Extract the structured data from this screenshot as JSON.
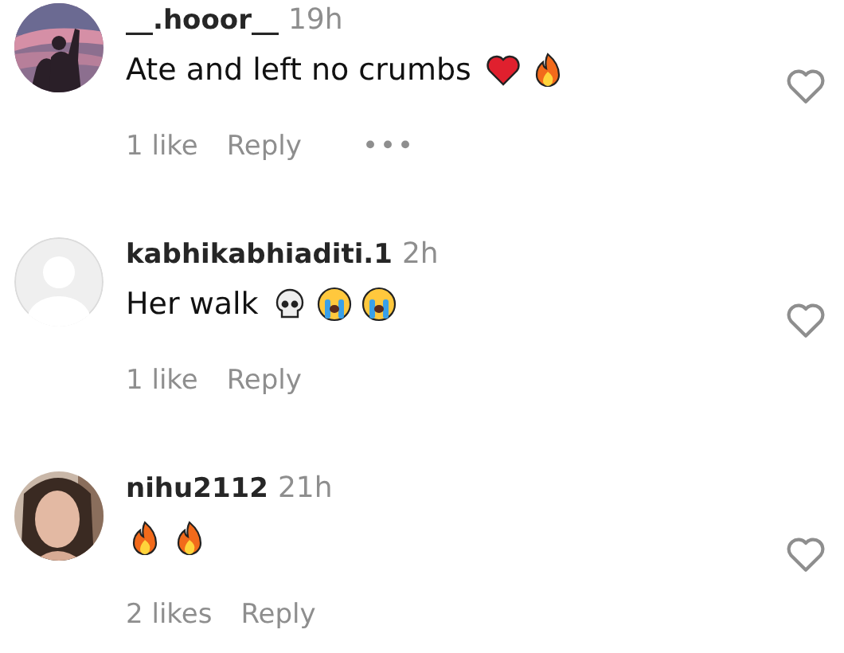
{
  "comments": [
    {
      "avatar": {
        "kind": "sunset"
      },
      "username": "__.hooor__",
      "time": "19h",
      "text": "Ate and left no crumbs",
      "emojis": [
        {
          "kind": "heart"
        },
        {
          "kind": "fire"
        }
      ],
      "likes": "1 like",
      "reply": "Reply",
      "more": "•••"
    },
    {
      "avatar": {
        "kind": "default"
      },
      "username": "kabhikabhiaditi.1",
      "time": "2h",
      "text": "Her walk",
      "emojis": [
        {
          "kind": "skull"
        },
        {
          "kind": "crying"
        },
        {
          "kind": "crying"
        }
      ],
      "likes": "1 like",
      "reply": "Reply"
    },
    {
      "avatar": {
        "kind": "portrait"
      },
      "username": "nihu2112",
      "time": "21h",
      "emojis": [
        {
          "kind": "fire"
        },
        {
          "kind": "fire"
        }
      ],
      "likes": "2 likes",
      "reply": "Reply"
    }
  ]
}
